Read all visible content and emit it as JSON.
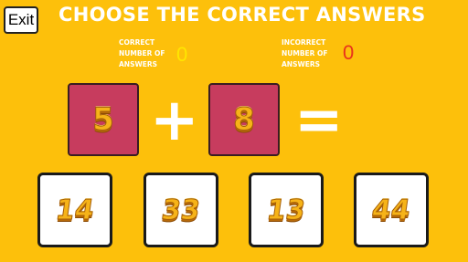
{
  "exit_label": "Exit",
  "title": "CHOOSE THE CORRECT ANSWERS",
  "score": {
    "correct_label": "CORRECT\nNUMBER OF\nANSWERS",
    "correct_value": "0",
    "incorrect_label": "INCORRECT\nNUMBER OF\nANSWERS",
    "incorrect_value": "0"
  },
  "equation": {
    "operand1": "5",
    "operator": "+",
    "operand2": "8",
    "equals": "="
  },
  "answers": [
    "14",
    "33",
    "13",
    "44"
  ],
  "colors": {
    "background": "#FDC00B",
    "card": "#C73C5E",
    "correct_value": "#FFE600",
    "incorrect_value": "#E8321C"
  }
}
